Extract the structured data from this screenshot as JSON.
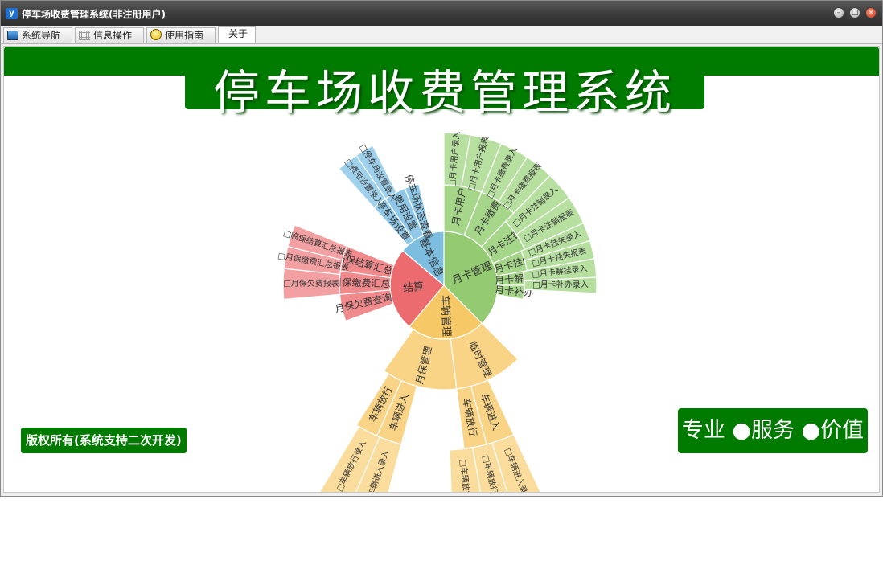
{
  "window": {
    "title": "停车场收费管理系统(非注册用户)",
    "icon": "app-logo-icon"
  },
  "tabs": [
    {
      "label": "系统导航",
      "icon": "monitor-icon"
    },
    {
      "label": "信息操作",
      "icon": "grid-icon"
    },
    {
      "label": "使用指南",
      "icon": "lightbulb-icon"
    },
    {
      "label": "关于",
      "icon": ""
    }
  ],
  "banner": {
    "title": "停车场收费管理系统"
  },
  "footer": {
    "copyright": "版权所有(系统支持二次开发)",
    "slogan": "专业 ●服务 ●价值"
  },
  "colors": {
    "green": "#007b00",
    "month_card": "#94ca72",
    "basic_info": "#7dbde0",
    "settlement": "#ec6b6f",
    "vehicle": "#f7c966"
  },
  "sunburst": {
    "ring1": [
      {
        "label": "月卡管理",
        "color": "month_card"
      },
      {
        "label": "车辆管理",
        "color": "vehicle"
      },
      {
        "label": "结算",
        "color": "settlement"
      },
      {
        "label": "基本信息",
        "color": "basic_info"
      }
    ],
    "ring2": [
      {
        "label": "月卡用户"
      },
      {
        "label": "月卡缴费"
      },
      {
        "label": "月卡注销"
      },
      {
        "label": "月卡挂失"
      },
      {
        "label": "月卡解挂"
      },
      {
        "label": "月卡补办"
      },
      {
        "label": "临时管理"
      },
      {
        "label": "月保管理"
      },
      {
        "label": "月保欠费查询"
      },
      {
        "label": "月保缴费汇总"
      },
      {
        "label": "临保结算汇总"
      },
      {
        "label": "停车场设置"
      },
      {
        "label": "费用设置"
      },
      {
        "label": "停车场状态查看"
      }
    ],
    "ring3": [
      {
        "label": "□月卡用户录入"
      },
      {
        "label": "□月卡用户报表"
      },
      {
        "label": "□月卡缴费录入"
      },
      {
        "label": "□月卡缴费报表"
      },
      {
        "label": "□月卡注销录入"
      },
      {
        "label": "□月卡注销报表"
      },
      {
        "label": "□月卡挂失录入"
      },
      {
        "label": "□月卡挂失报表"
      },
      {
        "label": "□月卡解挂录入"
      },
      {
        "label": "□月卡补办录入"
      },
      {
        "label": "□月保欠费报表"
      },
      {
        "label": "□月保缴费汇总报表"
      },
      {
        "label": "□临保结算汇总报表"
      },
      {
        "label": "□停车场设置录入"
      },
      {
        "label": "□费用设置录入"
      }
    ],
    "vehicle_ring2": [
      {
        "label": "车辆进入"
      },
      {
        "label": "车辆放行"
      },
      {
        "label": "车辆进入"
      },
      {
        "label": "车辆放行"
      }
    ],
    "vehicle_ring3": [
      {
        "label": "□车辆进入录入"
      },
      {
        "label": "□车辆放行报表"
      },
      {
        "label": "□车辆放行录入"
      },
      {
        "label": "□车辆进入录入"
      },
      {
        "label": "□车辆放行录入"
      }
    ]
  }
}
